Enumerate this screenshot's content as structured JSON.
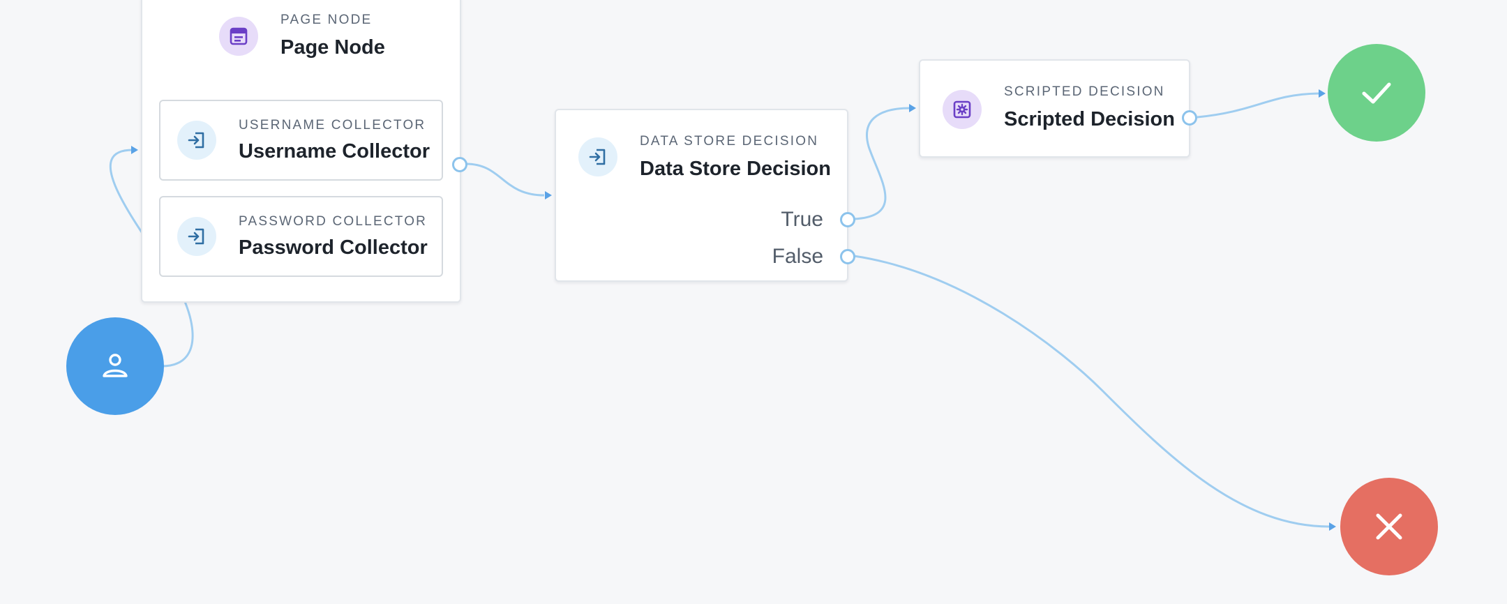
{
  "page_node": {
    "overline": "PAGE NODE",
    "title": "Page Node",
    "icon": "page-layout-icon",
    "children": [
      {
        "overline": "USERNAME COLLECTOR",
        "title": "Username Collector",
        "icon": "sign-in-icon"
      },
      {
        "overline": "PASSWORD COLLECTOR",
        "title": "Password Collector",
        "icon": "sign-in-icon"
      }
    ]
  },
  "data_store_decision": {
    "overline": "DATA STORE DECISION",
    "title": "Data Store Decision",
    "icon": "sign-in-icon",
    "outcomes": [
      "True",
      "False"
    ]
  },
  "scripted_decision": {
    "overline": "SCRIPTED DECISION",
    "title": "Scripted Decision",
    "icon": "script-gear-icon"
  },
  "start_node": {
    "icon": "user-icon",
    "color": "#4a9ee8"
  },
  "success_node": {
    "icon": "checkmark-icon",
    "color": "#6dd18a"
  },
  "failure_node": {
    "icon": "close-icon",
    "color": "#e56f62"
  },
  "colors": {
    "canvas_background": "#f6f7f9",
    "wire": "#9fcdf0",
    "icon_blue_bg": "#e3f1fb",
    "icon_purple_bg": "#e7dcf9",
    "icon_blue_fg": "#2f6ea3",
    "icon_purple_fg": "#6a3fc6"
  }
}
